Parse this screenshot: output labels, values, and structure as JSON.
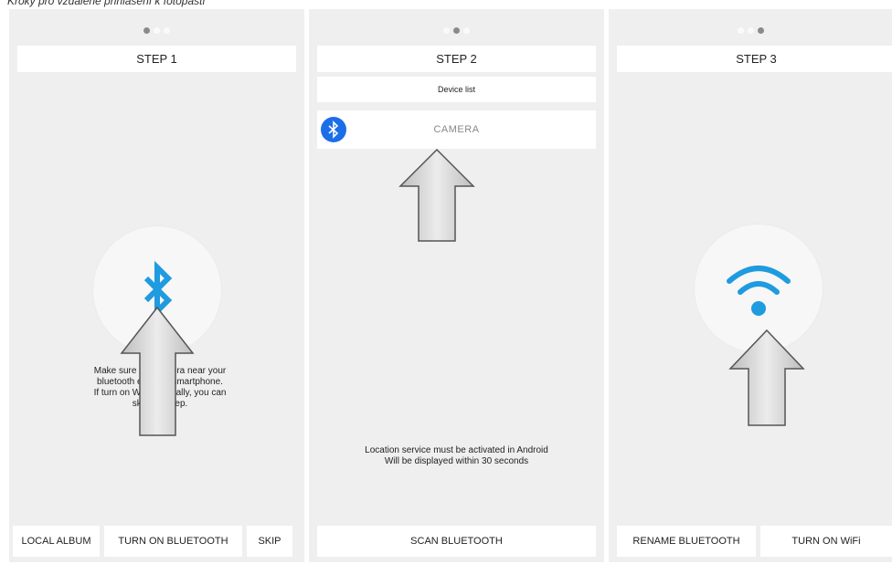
{
  "caption": "Kroky pro vzdálené přihlášení k fotopasti",
  "colors": {
    "panel_bg": "#efefef",
    "accent_blue": "#1f9be0",
    "badge_blue": "#1b6ee8",
    "arrow_gray": "#cfcfcf"
  },
  "step1": {
    "title": "STEP 1",
    "icon": "bluetooth-icon",
    "message": [
      "Make sure the camera near your",
      "bluetooth enabled smartphone.",
      "If turn on WiFi manually, you can",
      "skip this step."
    ],
    "buttons": {
      "local_album": "LOCAL ALBUM",
      "turn_on_bluetooth": "TURN ON BLUETOOTH",
      "skip": "SKIP"
    }
  },
  "step2": {
    "title": "STEP 2",
    "device_list_label": "Device list",
    "device_name": "CAMERA",
    "icon": "bluetooth-badge-icon",
    "message": [
      "Location service must be activated in Android",
      "Will be displayed within 30 seconds"
    ],
    "buttons": {
      "scan_bluetooth": "SCAN BLUETOOTH"
    }
  },
  "step3": {
    "title": "STEP 3",
    "icon": "wifi-icon",
    "buttons": {
      "rename_bluetooth": "RENAME BLUETOOTH",
      "turn_on_wifi": "TURN ON WiFi"
    }
  }
}
